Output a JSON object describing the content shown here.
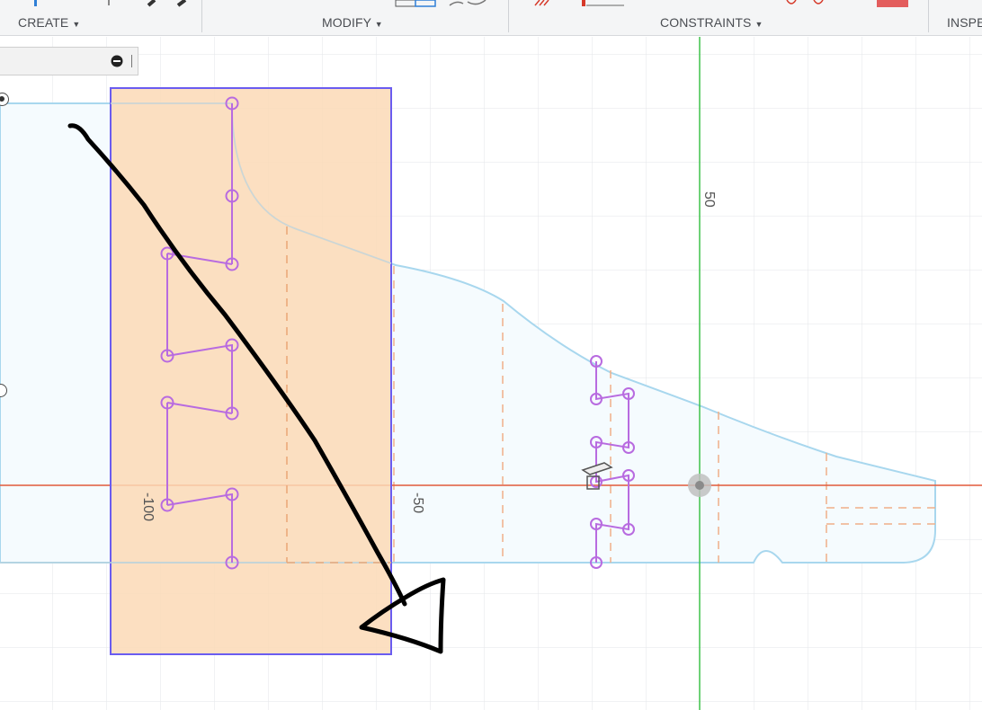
{
  "toolbar": {
    "groups": [
      {
        "label": "CREATE",
        "caret": "▼"
      },
      {
        "label": "MODIFY",
        "caret": "▼"
      },
      {
        "label": "CONSTRAINTS",
        "caret": "▼"
      },
      {
        "label": "INSPE",
        "caret": ""
      }
    ]
  },
  "canvas": {
    "axis_labels": {
      "vertical_50": "50",
      "horizontal_neg100": "-100",
      "horizontal_neg50": "-50"
    }
  },
  "colors": {
    "selection_fill": "#fcd9b6",
    "selection_stroke": "#6a5cf0",
    "x_axis": "#e25a3a",
    "y_axis": "#3ec24a",
    "profile_line": "#a8d7ee",
    "profile_fill": "#f5fbfe",
    "constraint_purple": "#b86be0",
    "dashed_orange": "#f0b088",
    "grid": "#dfe3e6",
    "annotation": "#000000"
  },
  "icons": [
    "minus-circle-icon",
    "radio-selected-icon",
    "radio-unselected-icon",
    "origin-point-icon",
    "sketch-plane-icon"
  ]
}
